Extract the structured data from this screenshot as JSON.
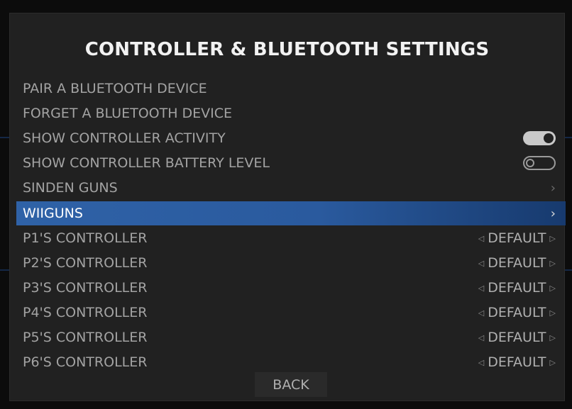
{
  "screen": {
    "title": "CONTROLLER & BLUETOOTH SETTINGS",
    "back_label": "BACK"
  },
  "menu": [
    {
      "label": "PAIR A BLUETOOTH DEVICE",
      "kind": "action"
    },
    {
      "label": "FORGET A BLUETOOTH DEVICE",
      "kind": "action"
    },
    {
      "label": "SHOW CONTROLLER ACTIVITY",
      "kind": "switch",
      "state": "on"
    },
    {
      "label": "SHOW CONTROLLER BATTERY LEVEL",
      "kind": "switch",
      "state": "off"
    },
    {
      "label": "SINDEN GUNS",
      "kind": "submenu",
      "chevron": "›"
    },
    {
      "label": "WIIGUNS",
      "kind": "submenu",
      "chevron": "›",
      "selected": true
    },
    {
      "label": "P1'S CONTROLLER",
      "kind": "option",
      "value": "DEFAULT"
    },
    {
      "label": "P2'S CONTROLLER",
      "kind": "option",
      "value": "DEFAULT"
    },
    {
      "label": "P3'S CONTROLLER",
      "kind": "option",
      "value": "DEFAULT"
    },
    {
      "label": "P4'S CONTROLLER",
      "kind": "option",
      "value": "DEFAULT"
    },
    {
      "label": "P5'S CONTROLLER",
      "kind": "option",
      "value": "DEFAULT"
    },
    {
      "label": "P6'S CONTROLLER",
      "kind": "option",
      "value": "DEFAULT"
    }
  ],
  "arrows": {
    "left": "◁",
    "right": "▷"
  },
  "colors": {
    "panel": "#212121",
    "selection": "#2f62a7",
    "text": "#a3a3a3",
    "title": "#f2f2f2"
  }
}
